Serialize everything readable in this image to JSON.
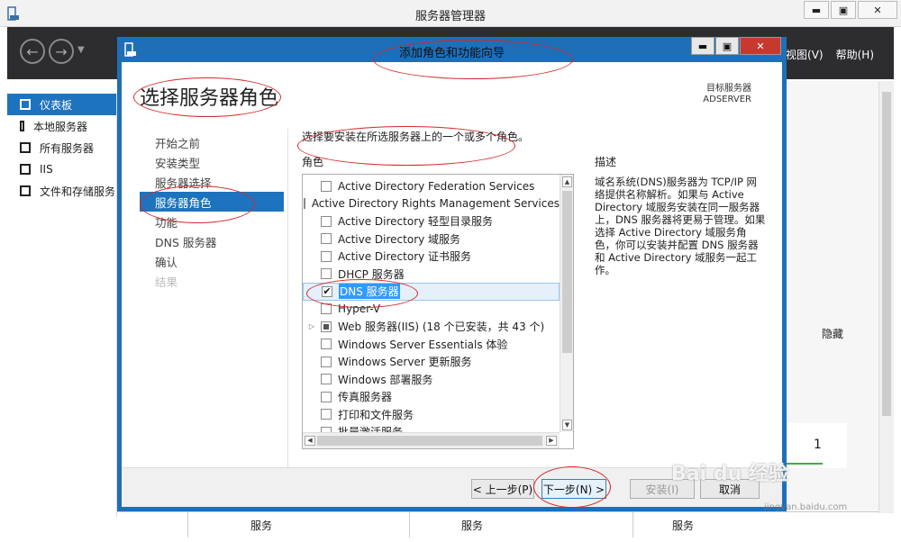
{
  "outer_window": {
    "title": "服务器管理器",
    "menu": [
      "视图(V)",
      "帮助(H)"
    ],
    "sidebar": [
      "仪表板",
      "本地服务器",
      "所有服务器",
      "IIS",
      "文件和存储服务"
    ],
    "hide_label": "隐藏",
    "tile_number": "1",
    "services": [
      "服务",
      "服务",
      "服务"
    ]
  },
  "dialog": {
    "title": "添加角色和功能向导",
    "page_title": "选择服务器角色",
    "target_label": "目标服务器",
    "target_server": "ADSERVER",
    "steps": [
      "开始之前",
      "安装类型",
      "服务器选择",
      "服务器角色",
      "功能",
      "DNS 服务器",
      "确认",
      "结果"
    ],
    "active_step_index": 3,
    "instruction": "选择要安装在所选服务器上的一个或多个角色。",
    "roles_header": "角色",
    "description_header": "描述",
    "description": "域名系统(DNS)服务器为 TCP/IP 网络提供名称解析。如果与 Active Directory 域服务安装在同一服务器上，DNS 服务器将更易于管理。如果选择 Active Directory 域服务角色，你可以安装并配置 DNS 服务器和 Active Directory 域服务一起工作。",
    "roles": [
      {
        "label": "Active Directory Federation Services",
        "checked": false
      },
      {
        "label": "Active Directory Rights Management Services",
        "checked": false
      },
      {
        "label": "Active Directory 轻型目录服务",
        "checked": false
      },
      {
        "label": "Active Directory 域服务",
        "checked": false
      },
      {
        "label": "Active Directory 证书服务",
        "checked": false
      },
      {
        "label": "DHCP 服务器",
        "checked": false
      },
      {
        "label": "DNS 服务器",
        "checked": true,
        "selected": true
      },
      {
        "label": "Hyper-V",
        "checked": false
      },
      {
        "label": "Web 服务器(IIS) (18 个已安装，共 43 个)",
        "checked": "partial",
        "expandable": true
      },
      {
        "label": "Windows Server Essentials 体验",
        "checked": false
      },
      {
        "label": "Windows Server 更新服务",
        "checked": false
      },
      {
        "label": "Windows 部署服务",
        "checked": false
      },
      {
        "label": "传真服务器",
        "checked": false
      },
      {
        "label": "打印和文件服务",
        "checked": false
      },
      {
        "label": "批量激活服务",
        "checked": false
      }
    ],
    "buttons": {
      "prev": "< 上一步(P)",
      "next": "下一步(N) >",
      "install": "安装(I)",
      "cancel": "取消"
    }
  },
  "watermark": {
    "text": "Bai du 经验",
    "url": "jingyan.baidu.com"
  }
}
